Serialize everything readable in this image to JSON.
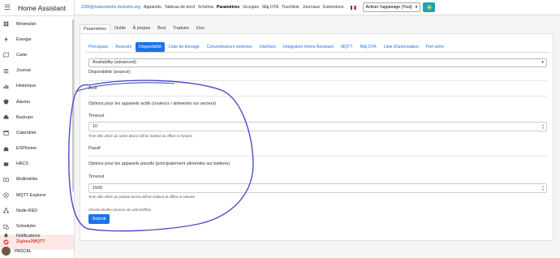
{
  "sidebar": {
    "title": "Home Assistant",
    "items": [
      {
        "label": "Minimalist",
        "icon": "dashboard-icon"
      },
      {
        "label": "Énergie",
        "icon": "lightning-icon"
      },
      {
        "label": "Carte",
        "icon": "map-icon"
      },
      {
        "label": "Journal",
        "icon": "list-icon"
      },
      {
        "label": "Historique",
        "icon": "chart-icon"
      },
      {
        "label": "Alarmo",
        "icon": "shield-icon"
      },
      {
        "label": "Backups",
        "icon": "backup-icon"
      },
      {
        "label": "Calendrier",
        "icon": "calendar-icon"
      },
      {
        "label": "ESPHome",
        "icon": "esphome-icon"
      },
      {
        "label": "HACS",
        "icon": "hacs-icon"
      },
      {
        "label": "Multimédia",
        "icon": "media-icon"
      },
      {
        "label": "MQTT Explorer",
        "icon": "mqtt-icon"
      },
      {
        "label": "Node-RED",
        "icon": "sitemap-icon"
      },
      {
        "label": "Scheduler",
        "icon": "calendar-clock-icon"
      },
      {
        "label": "Zigbee2MQTT",
        "icon": "zigbee-icon",
        "active": true
      }
    ],
    "notifications_label": "Notifications",
    "user_label": "PASCAL"
  },
  "topbar": {
    "email": "Z2M@maisonbelin.duckdns.org",
    "links": [
      "Appareils",
      "Tableau de bord",
      "Schéma",
      "Paramètres",
      "Groupes",
      "Màj OTA",
      "Touchlink",
      "Journaux",
      "Extensions"
    ],
    "active_link": "Paramètres",
    "permit_join": "Activer l'appairage (Tout)"
  },
  "main_tabs": [
    "Paramètres",
    "Outils",
    "À propos",
    "Brut",
    "Traduire",
    "Don"
  ],
  "active_main_tab": "Paramètres",
  "sub_tabs": [
    "Principaux",
    "Avancés",
    "Disponibilité",
    "Liste de blocage",
    "Convertisseurs externes",
    "Interface",
    "Intégration Home Assistant",
    "MQTT",
    "Màj OTA",
    "Liste d'autorisation",
    "Port série"
  ],
  "active_sub_tab": "Disponibilité",
  "form": {
    "select_value": "Availability (advanced)",
    "section_title": "Disponibilité (avancé)",
    "active": {
      "title": "Actif",
      "description": "Options pour les appareils actifs (routeurs / alimentés sur secteur)",
      "timeout_label": "Timeout",
      "timeout_value": "10",
      "help": "Time after which an active device will be marked as offline in minutes"
    },
    "passive": {
      "title": "Passif",
      "description": "Options pour les appareils passifs (principalement alimentés sur batterie)",
      "timeout_label": "Timeout",
      "timeout_value": "1500",
      "help": "Time after which an passive device will be marked as offline in minutes"
    },
    "checks_note": "Checks whether devices are online/offline",
    "submit_label": "Submit"
  },
  "colors": {
    "accent": "#1a73e8",
    "active_sidebar": "#db4437",
    "scribble": "#4b4fc8",
    "sun_button": "#17a2b8"
  }
}
